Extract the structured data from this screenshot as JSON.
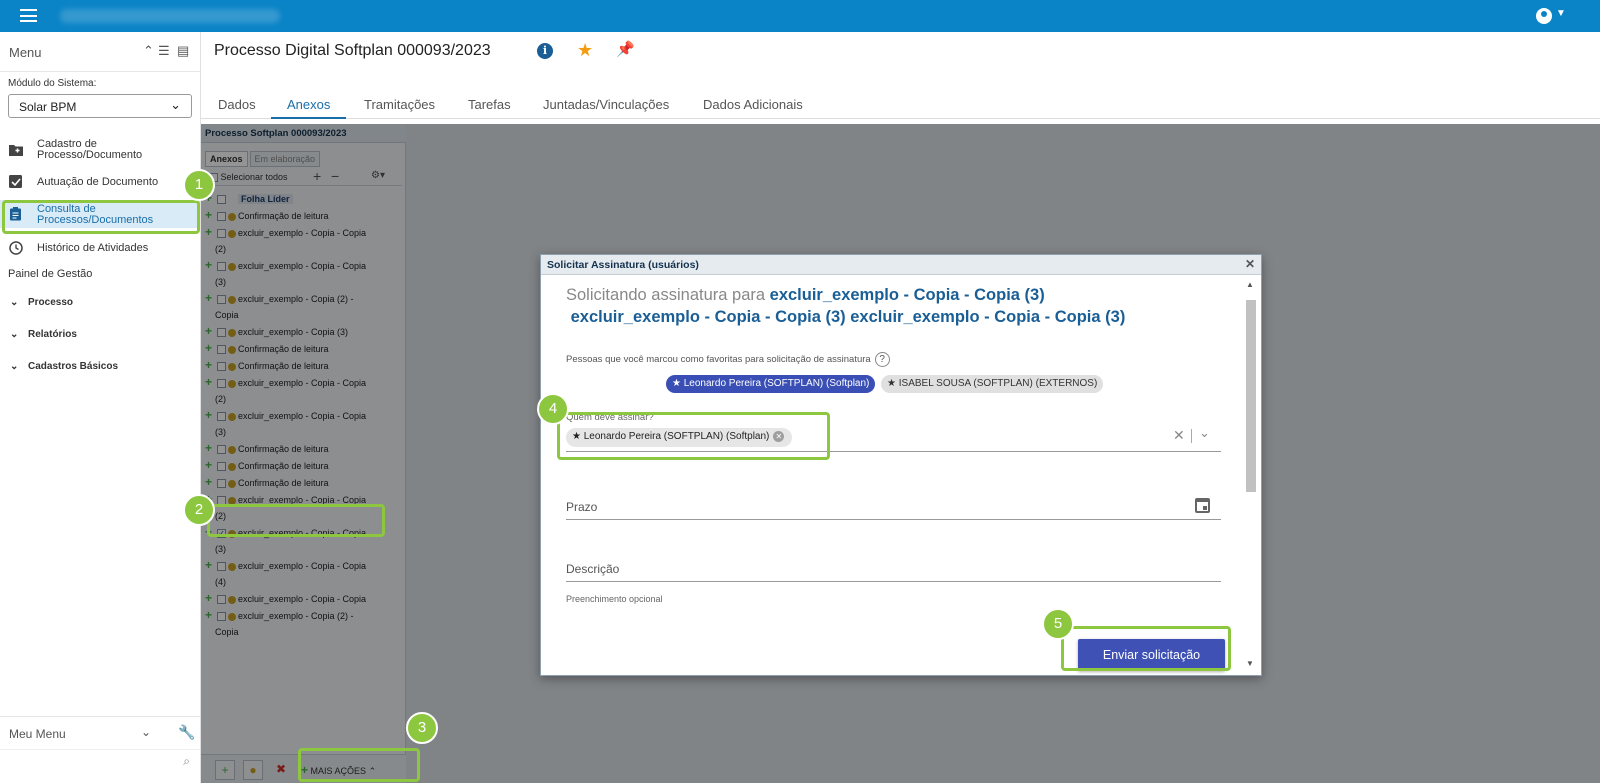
{
  "topbar": {
    "menu_icon": "hamburger-icon",
    "user_icon": "account-icon"
  },
  "sidebar": {
    "title": "Menu",
    "module_label": "Módulo do Sistema:",
    "module_value": "Solar BPM",
    "items": [
      {
        "label": "Cadastro de Processo/Documento",
        "icon": "folder-plus-icon"
      },
      {
        "label": "Autuação de Documento",
        "icon": "checkbox-icon"
      },
      {
        "label": "Consulta de Processos/Documentos",
        "icon": "clipboard-icon",
        "active": true
      },
      {
        "label": "Histórico de Atividades",
        "icon": "clock-icon"
      }
    ],
    "section_label": "Painel de Gestão",
    "groups": [
      "Processo",
      "Relatórios",
      "Cadastros Básicos"
    ],
    "bottom_title": "Meu Menu"
  },
  "header": {
    "title": "Processo Digital Softplan 000093/2023",
    "tabs": [
      "Dados",
      "Anexos",
      "Tramitações",
      "Tarefas",
      "Juntadas/Vinculações",
      "Dados Adicionais"
    ],
    "active_tab": "Anexos"
  },
  "tree": {
    "title": "Processo Softplan 000093/2023",
    "tabs": [
      "Anexos",
      "Em elaboração"
    ],
    "select_all": "Selecionar todos",
    "rows": [
      {
        "text": "Folha Líder",
        "cont": ""
      },
      {
        "text": "Confirmação de leitura",
        "cont": ""
      },
      {
        "text": "excluir_exemplo - Copia - Copia",
        "cont": "(2)"
      },
      {
        "text": "excluir_exemplo - Copia - Copia",
        "cont": "(3)"
      },
      {
        "text": "excluir_exemplo - Copia (2) -",
        "cont": "Copia"
      },
      {
        "text": "excluir_exemplo - Copia (3)",
        "cont": ""
      },
      {
        "text": "Confirmação de leitura",
        "cont": ""
      },
      {
        "text": "Confirmação de leitura",
        "cont": ""
      },
      {
        "text": "excluir_exemplo - Copia - Copia",
        "cont": "(2)"
      },
      {
        "text": "excluir_exemplo - Copia - Copia",
        "cont": "(3)"
      },
      {
        "text": "Confirmação de leitura",
        "cont": ""
      },
      {
        "text": "Confirmação de leitura",
        "cont": ""
      },
      {
        "text": "Confirmação de leitura",
        "cont": ""
      },
      {
        "text": "excluir_exemplo - Copia - Copia",
        "cont": "(2)"
      },
      {
        "text": "excluir_exemplo - Copia - Copia",
        "cont": "(3)",
        "checked": true
      },
      {
        "text": "excluir_exemplo - Copia - Copia",
        "cont": "(4)"
      },
      {
        "text": "excluir_exemplo - Copia - Copia",
        "cont": ""
      },
      {
        "text": "excluir_exemplo - Copia (2) -",
        "cont": "Copia"
      }
    ],
    "more_actions": "MAIS AÇÕES"
  },
  "modal": {
    "title": "Solicitar Assinatura (usuários)",
    "heading_prefix": "Solicitando assinatura para",
    "heading_docs": [
      "excluir_exemplo - Copia - Copia (3)",
      "excluir_exemplo - Copia - Copia (3)",
      "excluir_exemplo - Copia - Copia (3)"
    ],
    "favorites_label": "Pessoas que você marcou como favoritas para solicitação de assinatura",
    "favorites": [
      "Leonardo Pereira (SOFTPLAN) (Softplan)",
      "ISABEL SOUSA (SOFTPLAN) (EXTERNOS)"
    ],
    "signer_label": "Quem deve assinar?",
    "signer_selected": "Leonardo Pereira (SOFTPLAN) (Softplan)",
    "deadline_placeholder": "Prazo",
    "description_placeholder": "Descrição",
    "description_hint": "Preenchimento opcional",
    "submit_label": "Enviar solicitação"
  },
  "callouts": [
    "1",
    "2",
    "3",
    "4",
    "5"
  ],
  "colors": {
    "topbar": "#0a84c6",
    "primary_button": "#3f51b5",
    "callout": "#8dc63f",
    "link_blue": "#1a5e96"
  }
}
